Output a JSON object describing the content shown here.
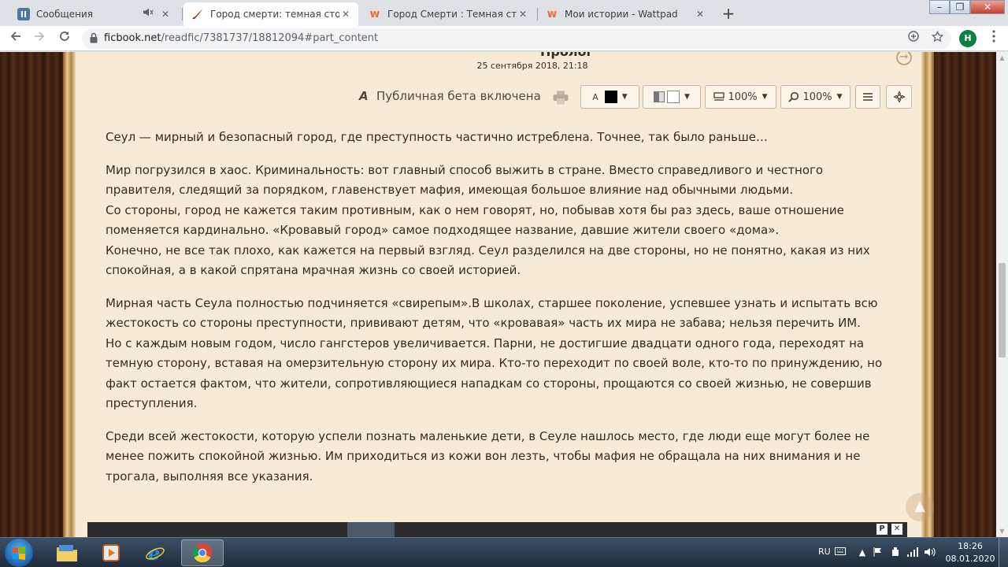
{
  "browser": {
    "tabs": [
      {
        "title": "Сообщения",
        "favicon": "vk-icon",
        "muted": true
      },
      {
        "title": "Город смерти: темная сторона",
        "favicon": "ficbook-icon",
        "active": true
      },
      {
        "title": "Город Смерти : Темная сторона",
        "favicon": "wattpad-icon"
      },
      {
        "title": "Мои истории - Wattpad",
        "favicon": "wattpad-icon"
      }
    ],
    "favicon_glyphs": {
      "vk": "II",
      "wattpad": "W"
    },
    "new_tab_label": "+",
    "close_glyph": "✕",
    "window_buttons": {
      "minimize": "–",
      "restore": "❐",
      "close": "✕"
    },
    "url": {
      "host": "ficbook.net",
      "path": "/readfic/7381737/18812094#part_content"
    },
    "profile_initial": "Н"
  },
  "page": {
    "chapter_title": "Пролог",
    "chapter_date": "25 сентября 2018, 21:18",
    "beta_label": "Публичная бета включена",
    "beta_icon_glyph": "A",
    "toolbar": {
      "font_color_label": "A",
      "font_color": "#000000",
      "bg_color": "#ffffff",
      "width_value": "100%",
      "zoom_value": "100%"
    },
    "paragraphs": [
      [
        "Сеул — мирный и безопасный город, где преступность частично истреблена. Точнее, так было раньше…"
      ],
      [
        "Мир погрузился в хаос. Криминальность: вот главный способ выжить в стране. Вместо справедливого и честного правителя, следящий за порядком, главенствует мафия, имеющая большое влияние над обычными людьми.",
        "Со стороны, город не кажется таким противным, как о нем говорят, но, побывав хотя бы раз здесь, ваше отношение поменяется кардинально. «Кровавый город» самое подходящее название, давшие жители своего «дома».",
        "Конечно, не все так плохо, как кажется на первый взгляд. Сеул разделился на две стороны, но не понятно, какая из них спокойная, а в какой спрятана мрачная жизнь со своей историей."
      ],
      [
        "Мирная часть Сеула полностью подчиняется «свирепым».В школах, старшее поколение, успевшее узнать и испытать всю жестокость со стороны преступности, прививают детям, что «кровавая» часть их мира не забава; нельзя перечить ИМ.",
        "Но с каждым новым годом, число гангстеров увеличивается. Парни, не достигшие двадцати одного года, переходят на темную сторону, вставая на омерзительную сторону их мира. Кто-то переходит по своей воле, кто-то по принуждению, но факт остается фактом, что жители, сопротивляющиеся нападкам со стороны, прощаются со своей жизнью, не совершив преступления."
      ],
      [
        "Среди всей жестокости, которую успели познать маленькие дети, в Сеуле нашлось место, где люди еще могут более не менее пожить спокойной жизнью. Им приходиться из кожи вон лезть, чтобы мафия не обращала на них внимания и не трогала, выполняя все указания."
      ]
    ],
    "ad_controls": {
      "info": "P",
      "close": "✕"
    }
  },
  "taskbar": {
    "apps": [
      {
        "name": "explorer",
        "icon": "folder-icon"
      },
      {
        "name": "media-player",
        "icon": "media-player-icon"
      },
      {
        "name": "internet-explorer",
        "icon": "ie-icon"
      },
      {
        "name": "chrome",
        "icon": "chrome-icon",
        "active": true
      }
    ],
    "lang": "RU",
    "time": "18:26",
    "date": "08.01.2020"
  },
  "colors": {
    "paper": "#f7ebd6",
    "text": "#3b2a1a",
    "wood": "#3e1f11",
    "frame_gold": "#e9c98c"
  }
}
